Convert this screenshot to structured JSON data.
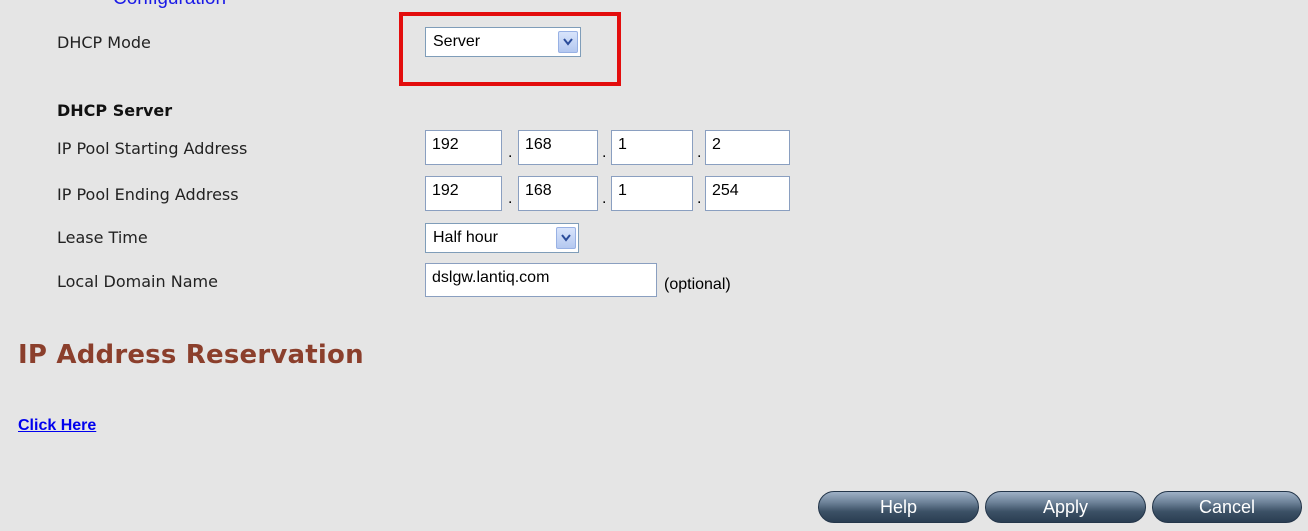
{
  "top_link": "Configuration",
  "dhcp_mode": {
    "label": "DHCP Mode",
    "value": "Server"
  },
  "server": {
    "section_title": "DHCP Server",
    "start": {
      "label": "IP Pool Starting Address",
      "octets": [
        "192",
        "168",
        "1",
        "2"
      ]
    },
    "end": {
      "label": "IP Pool Ending Address",
      "octets": [
        "192",
        "168",
        "1",
        "254"
      ]
    },
    "lease": {
      "label": "Lease Time",
      "value": "Half hour"
    },
    "domain": {
      "label": "Local Domain Name",
      "value": "dslgw.lantiq.com",
      "hint": "(optional)"
    }
  },
  "separator": ".",
  "reservation": {
    "heading": "IP Address Reservation",
    "link": "Click Here"
  },
  "buttons": {
    "help": "Help",
    "apply": "Apply",
    "cancel": "Cancel"
  },
  "colors": {
    "highlight_box": "#e30d0d",
    "heading": "#8b3f2c",
    "link": "#0000ee",
    "background": "#e5e5e5"
  }
}
